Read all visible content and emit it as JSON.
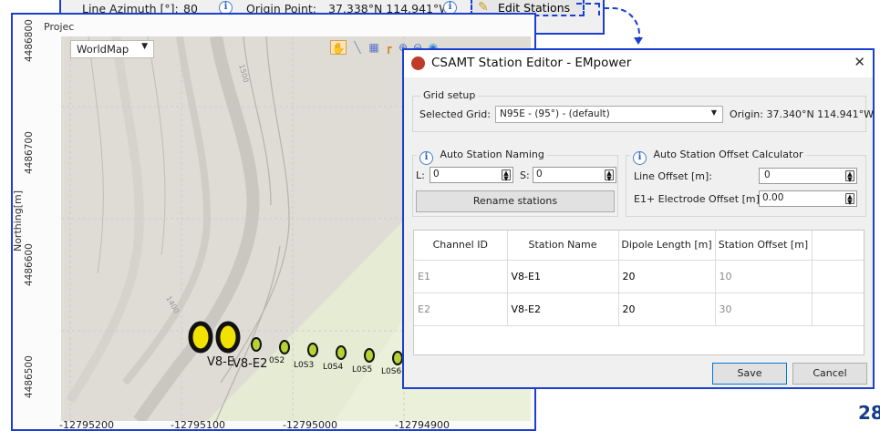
{
  "toolbar": {
    "azimuth_label": "Line Azimuth [°]:",
    "azimuth_value": "80",
    "origin_label": "Origin Point:",
    "origin_value": "37.338°N 114.941°W",
    "edit_button": "Edit Stations"
  },
  "map": {
    "title": "Projec",
    "basemap": "WorldMap",
    "y_axis_label": "Northing[m]",
    "y_ticks": [
      "4486800",
      "4486700",
      "4486600",
      "4486500"
    ],
    "x_ticks": [
      "-12795200",
      "-12795100",
      "-12795000",
      "-12794900"
    ],
    "contour_labels": [
      "1500",
      "1400"
    ],
    "station_labels": [
      "V8-E",
      "V8-E2",
      "0S2",
      "L0S3",
      "L0S4",
      "L0S5",
      "L0S6"
    ]
  },
  "dialog": {
    "title": "CSAMT Station Editor - EMpower",
    "grid_setup": {
      "group_title": "Grid setup",
      "selected_grid_label": "Selected Grid:",
      "selected_grid_value": "N95E - (95°) - (default)",
      "origin_text": "Origin: 37.340°N 114.941°W"
    },
    "auto_naming": {
      "group_title": "Auto Station Naming",
      "l_label": "L:",
      "l_value": "0",
      "s_label": "S:",
      "s_value": "0",
      "rename_button": "Rename stations"
    },
    "offset_calc": {
      "group_title": "Auto Station Offset Calculator",
      "line_offset_label": "Line Offset [m]:",
      "line_offset_value": "0",
      "electrode_offset_label": "E1+ Electrode Offset [m]:",
      "electrode_offset_value": "0.00"
    },
    "table": {
      "headers": [
        "Channel ID",
        "Station Name",
        "Dipole Length [m]",
        "Station Offset [m]"
      ],
      "rows": [
        [
          "E1",
          "V8-E1",
          "20",
          "10"
        ],
        [
          "E2",
          "V8-E2",
          "20",
          "30"
        ]
      ]
    },
    "save_button": "Save",
    "cancel_button": "Cancel"
  },
  "page_number": "28",
  "colors": {
    "annotation_blue": "#1a3fd1",
    "station_yellow": "#f2e200",
    "station_green": "#b6d233"
  },
  "icons": [
    "info-icon",
    "pencil-icon",
    "pan-hand-icon",
    "zoom-in-icon",
    "zoom-out-icon",
    "globe-icon",
    "close-icon",
    "dropdown-caret-icon",
    "spinner-arrows-icon"
  ]
}
